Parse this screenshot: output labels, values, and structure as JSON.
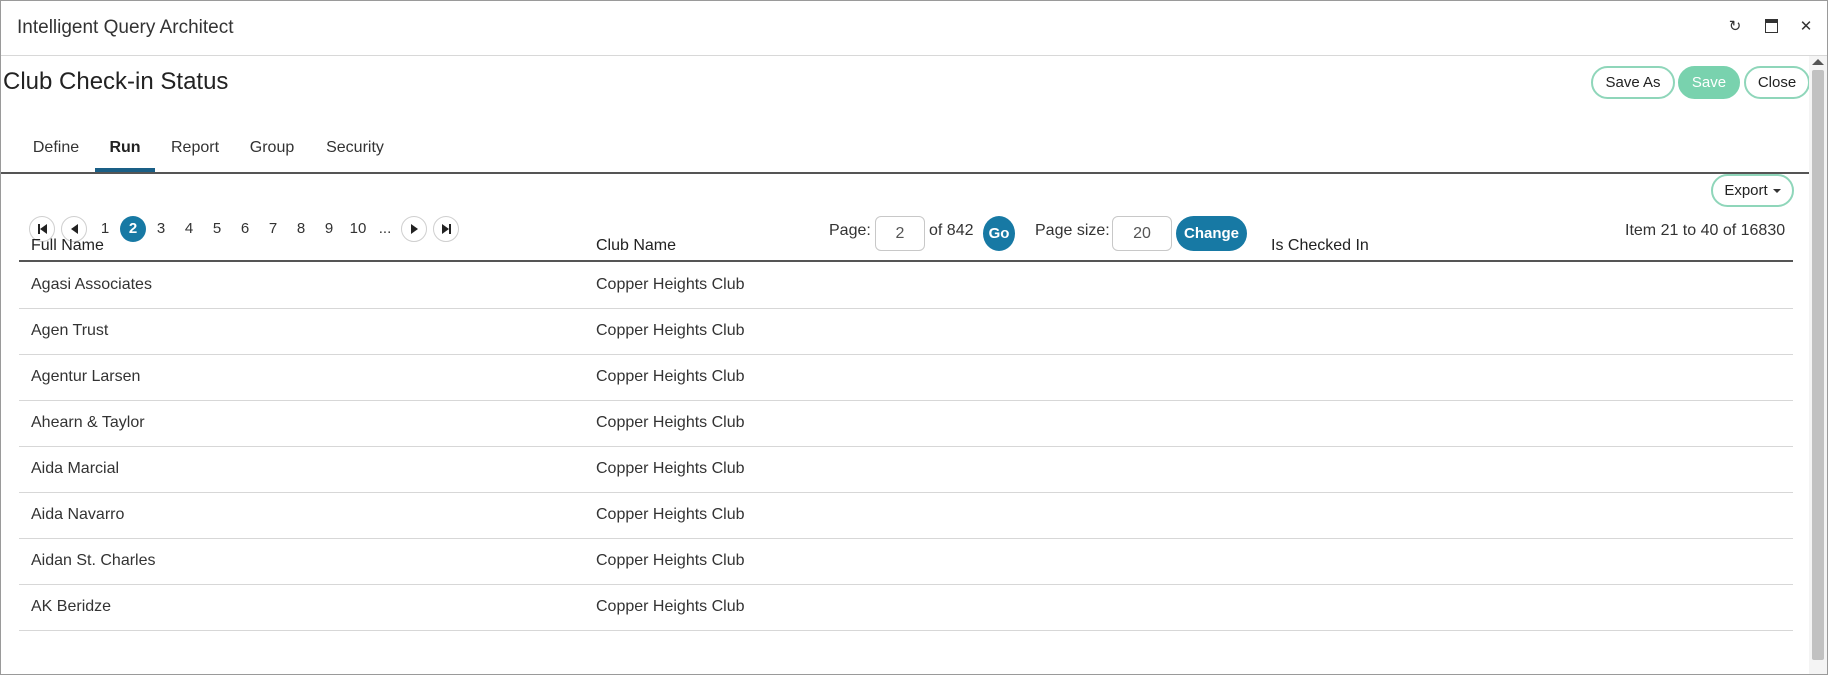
{
  "window": {
    "title": "Intelligent Query Architect",
    "icons": {
      "refresh": "refresh-icon",
      "maximize": "maximize-icon",
      "close": "close-icon"
    },
    "refresh_glyph": "↻",
    "close_glyph": "✕"
  },
  "page": {
    "title": "Club Check-in Status"
  },
  "actions": {
    "save_as": "Save As",
    "save": "Save",
    "close": "Close"
  },
  "tabs": [
    {
      "label": "Define",
      "active": false
    },
    {
      "label": "Run",
      "active": true
    },
    {
      "label": "Report",
      "active": false
    },
    {
      "label": "Group",
      "active": false
    },
    {
      "label": "Security",
      "active": false
    }
  ],
  "toolbar": {
    "export_label": "Export"
  },
  "pager": {
    "pages": [
      "1",
      "2",
      "3",
      "4",
      "5",
      "6",
      "7",
      "8",
      "9",
      "10",
      "..."
    ],
    "current_page": "2",
    "page_label": "Page:",
    "page_value": "2",
    "of_label": "of 842",
    "go_label": "Go",
    "page_size_label": "Page size:",
    "page_size_value": "20",
    "change_label": "Change",
    "item_range": "Item 21 to 40 of 16830"
  },
  "grid": {
    "columns": [
      "Full Name",
      "Club Name",
      "Is Checked In"
    ],
    "rows": [
      [
        "Agasi Associates",
        "Copper Heights Club",
        ""
      ],
      [
        "Agen Trust",
        "Copper Heights Club",
        ""
      ],
      [
        "Agentur Larsen",
        "Copper Heights Club",
        ""
      ],
      [
        "Ahearn & Taylor",
        "Copper Heights Club",
        ""
      ],
      [
        "Aida Marcial",
        "Copper Heights Club",
        ""
      ],
      [
        "Aida Navarro",
        "Copper Heights Club",
        ""
      ],
      [
        "Aidan St. Charles",
        "Copper Heights Club",
        ""
      ],
      [
        "AK Beridze",
        "Copper Heights Club",
        ""
      ]
    ]
  },
  "colors": {
    "accent": "#1779a4",
    "save_green": "#79d2ae",
    "outline_green": "#8fd6ba",
    "tab_underline": "#1a5f86"
  }
}
